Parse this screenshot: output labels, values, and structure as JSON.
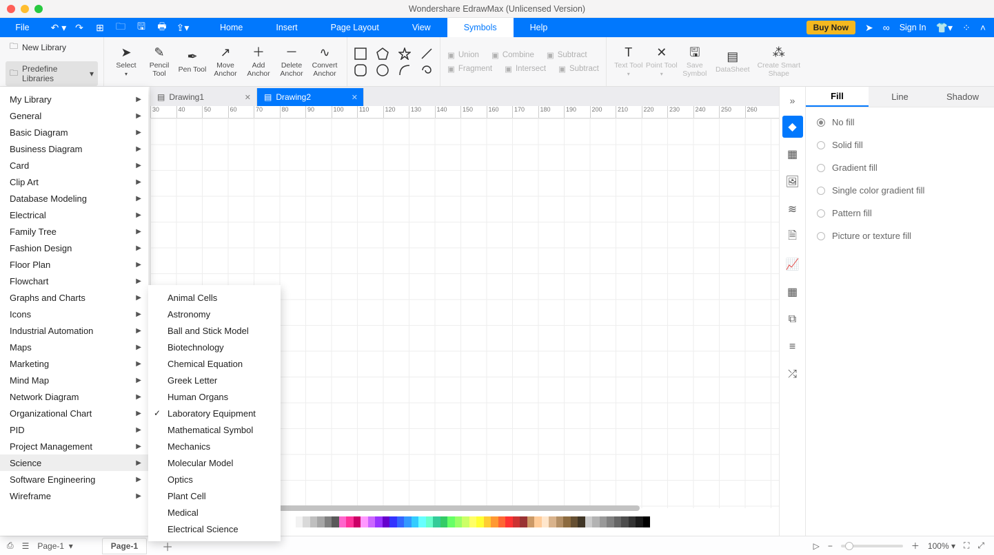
{
  "app": {
    "title": "Wondershare EdrawMax (Unlicensed Version)"
  },
  "menubar": {
    "file": "File",
    "tabs": [
      "Home",
      "Insert",
      "Page Layout",
      "View",
      "Symbols",
      "Help"
    ],
    "active_tab": "Symbols",
    "buy": "Buy Now",
    "signin": "Sign In"
  },
  "ribbon": {
    "new_library": "New Library",
    "predefine": "Predefine Libraries",
    "tools": {
      "select": "Select",
      "pencil": "Pencil Tool",
      "pen": "Pen Tool",
      "move": "Move Anchor",
      "add": "Add Anchor",
      "delete": "Delete Anchor",
      "convert": "Convert Anchor"
    },
    "bools": {
      "union": "Union",
      "combine": "Combine",
      "subtract": "Subtract",
      "fragment": "Fragment",
      "intersect": "Intersect",
      "subtract2": "Subtract"
    },
    "right": {
      "text": "Text Tool",
      "point": "Point Tool",
      "save": "Save Symbol",
      "datasheet": "DataSheet",
      "smart": "Create Smart Shape"
    }
  },
  "doc_tabs": {
    "items": [
      "Drawing1",
      "Drawing2"
    ],
    "active": "Drawing2"
  },
  "ruler_ticks": [
    "30",
    "40",
    "50",
    "60",
    "70",
    "80",
    "90",
    "100",
    "110",
    "120",
    "130",
    "140",
    "150",
    "160",
    "170",
    "180",
    "190",
    "200",
    "210",
    "220",
    "230",
    "240",
    "250",
    "260"
  ],
  "predefine_menu": [
    "My Library",
    "General",
    "Basic Diagram",
    "Business Diagram",
    "Card",
    "Clip Art",
    "Database Modeling",
    "Electrical",
    "Family Tree",
    "Fashion Design",
    "Floor Plan",
    "Flowchart",
    "Graphs and Charts",
    "Icons",
    "Industrial Automation",
    "Maps",
    "Marketing",
    "Mind Map",
    "Network Diagram",
    "Organizational Chart",
    "PID",
    "Project Management",
    "Science",
    "Software Engineering",
    "Wireframe"
  ],
  "predefine_hover": "Science",
  "science_submenu": [
    "Animal Cells",
    "Astronomy",
    "Ball and Stick Model",
    "Biotechnology",
    "Chemical Equation",
    "Greek Letter",
    "Human Organs",
    "Laboratory Equipment",
    "Mathematical Symbol",
    "Mechanics",
    "Molecular Model",
    "Optics",
    "Plant Cell",
    "Medical",
    "Electrical Science"
  ],
  "science_checked": "Laboratory Equipment",
  "side_tabs_active": 0,
  "prop_panel": {
    "tabs": [
      "Fill",
      "Line",
      "Shadow"
    ],
    "active": "Fill",
    "fill_options": [
      "No fill",
      "Solid fill",
      "Gradient fill",
      "Single color gradient fill",
      "Pattern fill",
      "Picture or texture fill"
    ],
    "fill_selected": "No fill"
  },
  "palette_colors": [
    "#ffffff",
    "#f2f2f2",
    "#d9d9d9",
    "#bfbfbf",
    "#a6a6a6",
    "#808080",
    "#595959",
    "#ff66cc",
    "#ff3399",
    "#cc0066",
    "#ff99ff",
    "#cc66ff",
    "#9933ff",
    "#6600cc",
    "#3333ff",
    "#3366ff",
    "#3399ff",
    "#33ccff",
    "#66ffff",
    "#66ffcc",
    "#33cc99",
    "#33cc66",
    "#66ff66",
    "#99ff66",
    "#ccff66",
    "#ffff66",
    "#ffff33",
    "#ffcc33",
    "#ff9933",
    "#ff6633",
    "#ff3333",
    "#cc3333",
    "#993333",
    "#cc9966",
    "#ffcc99",
    "#ffe6cc",
    "#d9b38c",
    "#b38f66",
    "#8c6b40",
    "#665033",
    "#403626",
    "#cccccc",
    "#b3b3b3",
    "#999999",
    "#808080",
    "#666666",
    "#4d4d4d",
    "#333333",
    "#1a1a1a",
    "#000000"
  ],
  "status": {
    "page_selector": "Page-1",
    "page_tab": "Page-1",
    "zoom": "100%"
  }
}
